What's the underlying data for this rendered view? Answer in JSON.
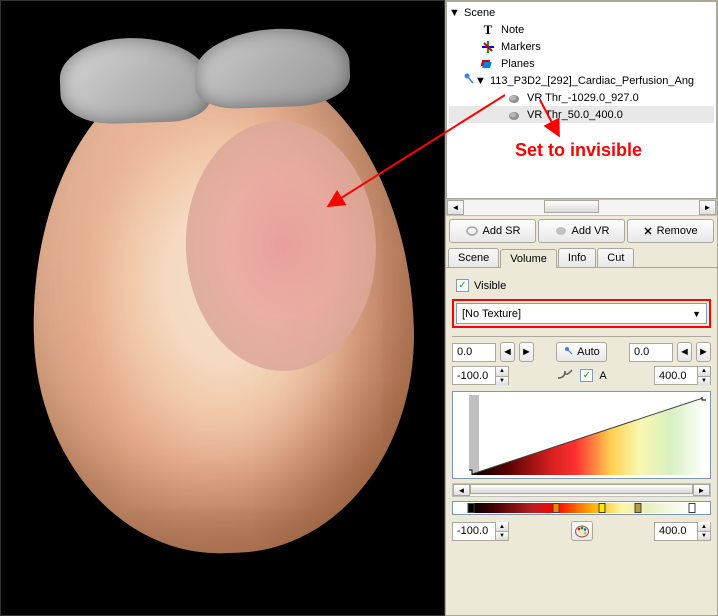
{
  "annotation": {
    "text": "Set to invisible"
  },
  "tree": {
    "root": "Scene",
    "items": [
      {
        "label": "Note",
        "icon": "T"
      },
      {
        "label": "Markers",
        "icon": "markers"
      },
      {
        "label": "Planes",
        "icon": "planes"
      },
      {
        "label": "113_P3D2_[292]_Cardiac_Perfusion_Ang",
        "icon": "study",
        "expanded": true
      },
      {
        "label": "VR Thr_-1029.0_927.0",
        "icon": "vr",
        "indent": 2
      },
      {
        "label": "VR Thr_50.0_400.0",
        "icon": "vr",
        "indent": 2,
        "selected": true
      }
    ]
  },
  "buttons": {
    "add_sr": "Add SR",
    "add_vr": "Add VR",
    "remove": "Remove"
  },
  "tabs": {
    "scene": "Scene",
    "volume": "Volume",
    "info": "Info",
    "cut": "Cut"
  },
  "volume": {
    "visible_label": "Visible",
    "visible_checked": true,
    "texture": "[No Texture]",
    "window_low": "0.0",
    "window_high": "0.0",
    "auto_label": "Auto",
    "range_low": "-100.0",
    "range_high": "400.0",
    "alpha_label": "A",
    "alpha_checked": true,
    "color_low": "-100.0",
    "color_high": "400.0"
  },
  "icons": {
    "triangle_down": "▼",
    "triangle_right": "▶",
    "arrow_left": "◄",
    "arrow_right": "►",
    "close_x": "✕",
    "check": "✓"
  }
}
